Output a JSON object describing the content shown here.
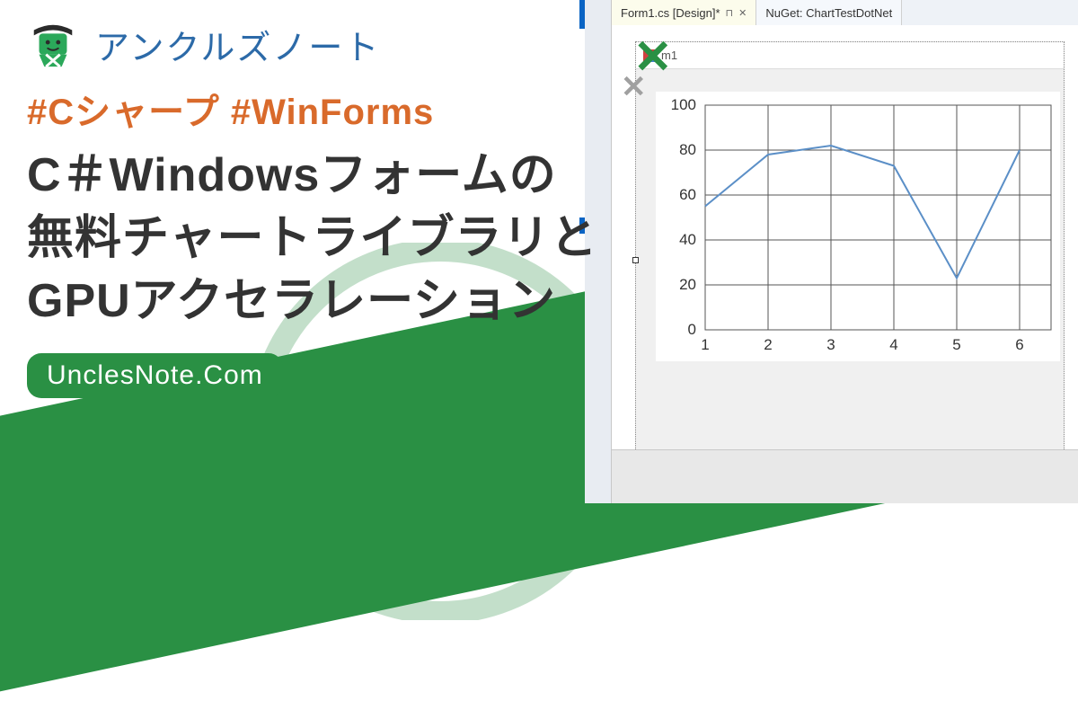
{
  "site_name": "アンクルズノート",
  "tags_line": "#Cシャープ #WinForms",
  "article_title": "C＃Windowsフォームの無料チャートライブラリとGPUアクセラレーション",
  "domain_text": "UnclesNote.Com",
  "vs": {
    "tab_active": "Form1.cs [Design]*",
    "tab_pin": "⊓",
    "tab_close": "✕",
    "tab_inactive": "NuGet: ChartTestDotNet",
    "form_title": "m1"
  },
  "chart_data": {
    "type": "line",
    "x": [
      1,
      2,
      3,
      4,
      5,
      6
    ],
    "values": [
      55,
      78,
      82,
      73,
      23,
      80
    ],
    "xlabel": "",
    "ylabel": "",
    "xlim": [
      1,
      6.5
    ],
    "ylim": [
      0,
      100
    ],
    "y_ticks": [
      0,
      20,
      40,
      60,
      80,
      100
    ],
    "x_ticks": [
      1,
      2,
      3,
      4,
      5,
      6
    ],
    "line_color": "#5b8fc7",
    "grid": true
  }
}
